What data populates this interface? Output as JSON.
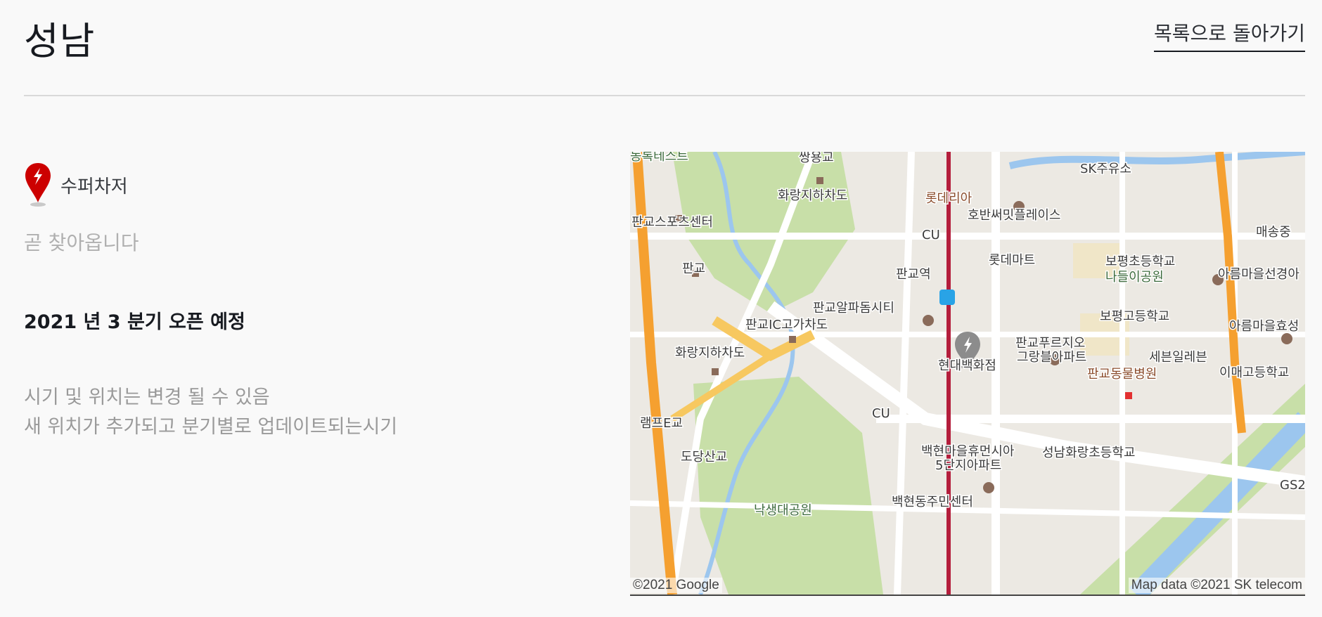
{
  "header": {
    "title": "성남",
    "back_label": "목록으로 돌아가기"
  },
  "info": {
    "charger_type": "수퍼차저",
    "status": "곧 찾아옵니다",
    "open_date": "2021 년 3 분기 오픈 예정",
    "note_line1": "시기 및 위치는 변경 될 수 있음",
    "note_line2": "새 위치가 추가되고 분기별로 업데이트되는시기"
  },
  "colors": {
    "pin_red": "#cc0000",
    "text_dark": "#171a20",
    "text_muted": "#9a9a9a",
    "subway_line": "#b41e3c",
    "highway": "#f5a030",
    "park": "#c8dfa8",
    "water": "#9cc6ee"
  },
  "map": {
    "attribution_left": "©2021 Google",
    "attribution_right": "Map data ©2021 SK telecom",
    "labels": [
      {
        "text": "동록테스트",
        "cls": "green"
      },
      {
        "text": "쌍용교",
        "cls": ""
      },
      {
        "text": "SK주유소",
        "cls": ""
      },
      {
        "text": "화랑지하차도",
        "cls": ""
      },
      {
        "text": "롯데리아",
        "cls": "brown"
      },
      {
        "text": "호반써밋플레이스",
        "cls": ""
      },
      {
        "text": "판교스포츠센터",
        "cls": ""
      },
      {
        "text": "CU",
        "cls": ""
      },
      {
        "text": "매송중",
        "cls": ""
      },
      {
        "text": "롯데마트",
        "cls": ""
      },
      {
        "text": "보평초등학교",
        "cls": ""
      },
      {
        "text": "판교",
        "cls": ""
      },
      {
        "text": "나들이공원",
        "cls": "green"
      },
      {
        "text": "판교역",
        "cls": ""
      },
      {
        "text": "아름마을선경아",
        "cls": ""
      },
      {
        "text": "판교알파돔시티",
        "cls": ""
      },
      {
        "text": "보평고등학교",
        "cls": ""
      },
      {
        "text": "판교IC고가차도",
        "cls": ""
      },
      {
        "text": "아름마을효성",
        "cls": ""
      },
      {
        "text": "판교푸르지오",
        "cls": ""
      },
      {
        "text": "그랑블아파트",
        "cls": ""
      },
      {
        "text": "화랑지하차도",
        "cls": ""
      },
      {
        "text": "세븐일레븐",
        "cls": ""
      },
      {
        "text": "현대백화점",
        "cls": ""
      },
      {
        "text": "판교동물병원",
        "cls": "brown"
      },
      {
        "text": "이매고등학교",
        "cls": ""
      },
      {
        "text": "CU",
        "cls": ""
      },
      {
        "text": "램프E교",
        "cls": ""
      },
      {
        "text": "백현마을휴먼시아",
        "cls": ""
      },
      {
        "text": "5단지아파트",
        "cls": ""
      },
      {
        "text": "성남화랑초등학교",
        "cls": ""
      },
      {
        "text": "도당산교",
        "cls": ""
      },
      {
        "text": "GS2",
        "cls": ""
      },
      {
        "text": "백현동주민센터",
        "cls": ""
      },
      {
        "text": "낙생대공원",
        "cls": "green"
      }
    ]
  }
}
